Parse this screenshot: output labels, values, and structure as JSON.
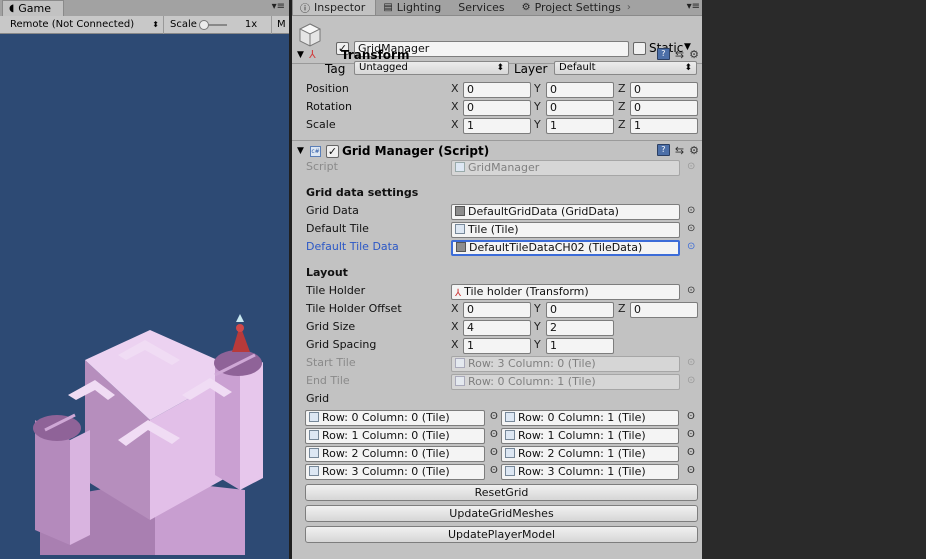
{
  "game": {
    "tab_label": "Game",
    "menu_glyph": "▾≡",
    "display": "Remote (Not Connected)",
    "scale_label": "Scale",
    "scale_value": "1x",
    "maximize_cut": "M"
  },
  "inspector": {
    "tabs": [
      {
        "label": "Inspector",
        "icon": "info-icon"
      },
      {
        "label": "Lighting",
        "icon": "lighting-icon"
      },
      {
        "label": "Services",
        "icon": ""
      },
      {
        "label": "Project Settings",
        "icon": "gear-icon"
      }
    ],
    "overflow_arrow": "›",
    "menu_glyph": "▾≡",
    "object_name": "GridManager",
    "static_label": "Static",
    "tag_label": "Tag",
    "tag_value": "Untagged",
    "layer_label": "Layer",
    "layer_value": "Default"
  },
  "transform": {
    "title": "Transform",
    "rows": [
      {
        "label": "Position",
        "x": "0",
        "y": "0",
        "z": "0"
      },
      {
        "label": "Rotation",
        "x": "0",
        "y": "0",
        "z": "0"
      },
      {
        "label": "Scale",
        "x": "1",
        "y": "1",
        "z": "1"
      }
    ]
  },
  "grid_manager": {
    "title": "Grid Manager (Script)",
    "script_label": "Script",
    "script_value": "GridManager",
    "section_data": "Grid data settings",
    "grid_data_label": "Grid Data",
    "grid_data_value": "DefaultGridData (GridData)",
    "default_tile_label": "Default Tile",
    "default_tile_value": "Tile (Tile)",
    "default_tile_data_label": "Default Tile Data",
    "default_tile_data_value": "DefaultTileDataCH02 (TileData)",
    "section_layout": "Layout",
    "tile_holder_label": "Tile Holder",
    "tile_holder_value": "Tile holder (Transform)",
    "tile_holder_offset_label": "Tile Holder Offset",
    "tile_holder_offset": {
      "x": "0",
      "y": "0",
      "z": "0"
    },
    "grid_size_label": "Grid Size",
    "grid_size": {
      "x": "4",
      "y": "2"
    },
    "grid_spacing_label": "Grid Spacing",
    "grid_spacing": {
      "x": "1",
      "y": "1"
    },
    "start_tile_label": "Start Tile",
    "start_tile_value": "Row: 3 Column: 0 (Tile)",
    "end_tile_label": "End Tile",
    "end_tile_value": "Row: 0 Column: 1 (Tile)",
    "grid_label": "Grid",
    "grid_cells": [
      [
        "Row: 0 Column: 0 (Tile)",
        "Row: 0 Column: 1 (Tile)"
      ],
      [
        "Row: 1 Column: 0 (Tile)",
        "Row: 1 Column: 1 (Tile)"
      ],
      [
        "Row: 2 Column: 0 (Tile)",
        "Row: 2 Column: 1 (Tile)"
      ],
      [
        "Row: 3 Column: 0 (Tile)",
        "Row: 3 Column: 1 (Tile)"
      ]
    ],
    "buttons": [
      "ResetGrid",
      "UpdateGridMeshes",
      "UpdatePlayerModel"
    ]
  },
  "axis": {
    "x": "X",
    "y": "Y",
    "z": "Z"
  },
  "colors": {
    "game_bg": "#2d4a74",
    "inspector_bg": "#c2c2c2",
    "tile_top": "#e8c6ee",
    "tile_side": "#a97fb1",
    "highlight_label": "#2c58c6"
  }
}
